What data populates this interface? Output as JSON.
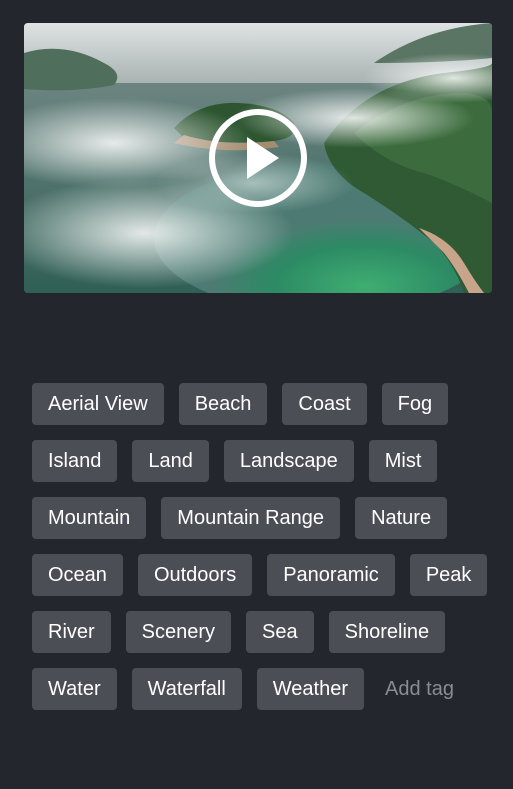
{
  "video": {
    "play_icon": "play-icon",
    "play_color": "#ffffff"
  },
  "tags": [
    "Aerial View",
    "Beach",
    "Coast",
    "Fog",
    "Island",
    "Land",
    "Landscape",
    "Mist",
    "Mountain",
    "Mountain Range",
    "Nature",
    "Ocean",
    "Outdoors",
    "Panoramic",
    "Peak",
    "River",
    "Scenery",
    "Sea",
    "Shoreline",
    "Water",
    "Waterfall",
    "Weather"
  ],
  "add_tag_placeholder": "Add tag",
  "colors": {
    "background": "#24262e",
    "tag_background": "#4c4e55",
    "tag_text": "#ffffff",
    "placeholder_text": "#8a8c92"
  }
}
